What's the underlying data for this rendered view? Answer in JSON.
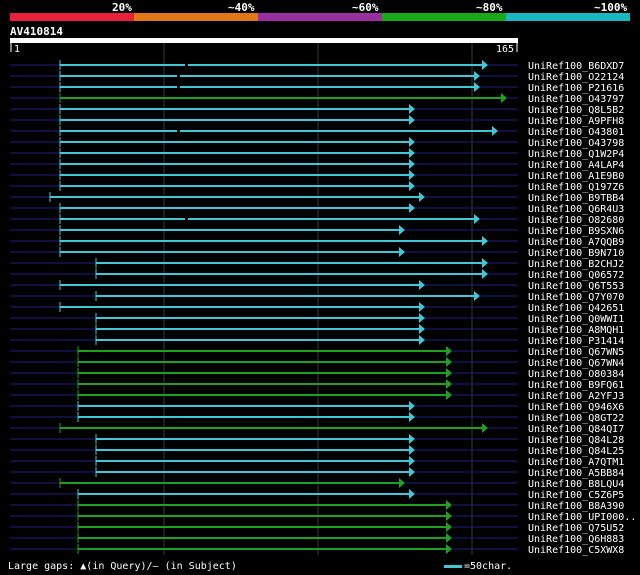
{
  "legend": {
    "bands": [
      {
        "label": "",
        "color": "#e8203a"
      },
      {
        "label": "20%",
        "color": "#e07818"
      },
      {
        "label": "~40%",
        "color": "#9a30a0"
      },
      {
        "label": "~60%",
        "color": "#18a818"
      },
      {
        "label": "~80%",
        "color": "#18b8c0"
      }
    ],
    "labels": [
      "20%",
      "~40%",
      "~60%",
      "~80%",
      "~100%"
    ]
  },
  "query": {
    "name": "AV410814",
    "start": "1",
    "end": "165"
  },
  "colors": {
    "cyan": "#40c8d8",
    "green": "#20a020",
    "backbone": "#202080",
    "grid": "#3a3a3a"
  },
  "hits": [
    {
      "name": "UniRef100_B6DXD7",
      "color": "cyan",
      "gap": 1
    },
    {
      "name": "UniRef100_O22124",
      "color": "cyan",
      "gap": 1
    },
    {
      "name": "UniRef100_P21616",
      "color": "cyan",
      "gap": 1
    },
    {
      "name": "UniRef100_O43797",
      "color": "green",
      "gap": 0
    },
    {
      "name": "UniRef100_Q8L5B2",
      "color": "cyan",
      "gap": 0
    },
    {
      "name": "UniRef100_A9PFH8",
      "color": "cyan",
      "gap": 0
    },
    {
      "name": "UniRef100_O43801",
      "color": "cyan",
      "gap": 1
    },
    {
      "name": "UniRef100_O43798",
      "color": "cyan",
      "gap": 0
    },
    {
      "name": "UniRef100_Q1W2P4",
      "color": "cyan",
      "gap": 0
    },
    {
      "name": "UniRef100_A4LAP4",
      "color": "cyan",
      "gap": 0
    },
    {
      "name": "UniRef100_A1E9B0",
      "color": "cyan",
      "gap": 0
    },
    {
      "name": "UniRef100_Q197Z6",
      "color": "cyan",
      "gap": 0
    },
    {
      "name": "UniRef100_B9TBB4",
      "color": "cyan",
      "gap": 0
    },
    {
      "name": "UniRef100_Q6R4U3",
      "color": "cyan",
      "gap": 0
    },
    {
      "name": "UniRef100_O82680",
      "color": "cyan",
      "gap": 1
    },
    {
      "name": "UniRef100_B9SXN6",
      "color": "cyan",
      "gap": 0
    },
    {
      "name": "UniRef100_A7QQB9",
      "color": "cyan",
      "gap": 0
    },
    {
      "name": "UniRef100_B9N710",
      "color": "cyan",
      "gap": 0
    },
    {
      "name": "UniRef100_B2CHJ2",
      "color": "cyan",
      "gap": 0
    },
    {
      "name": "UniRef100_Q06572",
      "color": "cyan",
      "gap": 0
    },
    {
      "name": "UniRef100_Q6T553",
      "color": "cyan",
      "gap": 0
    },
    {
      "name": "UniRef100_Q7Y070",
      "color": "cyan",
      "gap": 0
    },
    {
      "name": "UniRef100_Q42651",
      "color": "cyan",
      "gap": 0
    },
    {
      "name": "UniRef100_Q0WWI1",
      "color": "cyan",
      "gap": 0
    },
    {
      "name": "UniRef100_A8MQH1",
      "color": "cyan",
      "gap": 0
    },
    {
      "name": "UniRef100_P31414",
      "color": "cyan",
      "gap": 0
    },
    {
      "name": "UniRef100_Q67WN5",
      "color": "green",
      "gap": 0
    },
    {
      "name": "UniRef100_Q67WN4",
      "color": "green",
      "gap": 0
    },
    {
      "name": "UniRef100_O80384",
      "color": "green",
      "gap": 0
    },
    {
      "name": "UniRef100_B9FQ61",
      "color": "green",
      "gap": 0
    },
    {
      "name": "UniRef100_A2YFJ3",
      "color": "green",
      "gap": 0
    },
    {
      "name": "UniRef100_Q946X6",
      "color": "cyan",
      "gap": 0
    },
    {
      "name": "UniRef100_Q8GT22",
      "color": "cyan",
      "gap": 0
    },
    {
      "name": "UniRef100_Q84QI7",
      "color": "green",
      "gap": 0
    },
    {
      "name": "UniRef100_Q84L28",
      "color": "cyan",
      "gap": 0
    },
    {
      "name": "UniRef100_Q84L25",
      "color": "cyan",
      "gap": 0
    },
    {
      "name": "UniRef100_A7QTM1",
      "color": "cyan",
      "gap": 0
    },
    {
      "name": "UniRef100_A5BB84",
      "color": "cyan",
      "gap": 0
    },
    {
      "name": "UniRef100_B8LQU4",
      "color": "green",
      "gap": 0
    },
    {
      "name": "UniRef100_C5Z6P5",
      "color": "cyan",
      "gap": 0
    },
    {
      "name": "UniRef100_B8A390",
      "color": "green",
      "gap": 0
    },
    {
      "name": "UniRef100_UPI000..",
      "color": "green",
      "gap": 0
    },
    {
      "name": "UniRef100_Q75U52",
      "color": "green",
      "gap": 0
    },
    {
      "name": "UniRef100_Q6H883",
      "color": "green",
      "gap": 0
    },
    {
      "name": "UniRef100_C5XWX8",
      "color": "green",
      "gap": 0
    }
  ],
  "footer": {
    "gaps_label": "Large gaps:",
    "query_gap_label": "(in Query)/",
    "subject_gap_label": "(in Subject)",
    "scale_label": "=50char."
  }
}
